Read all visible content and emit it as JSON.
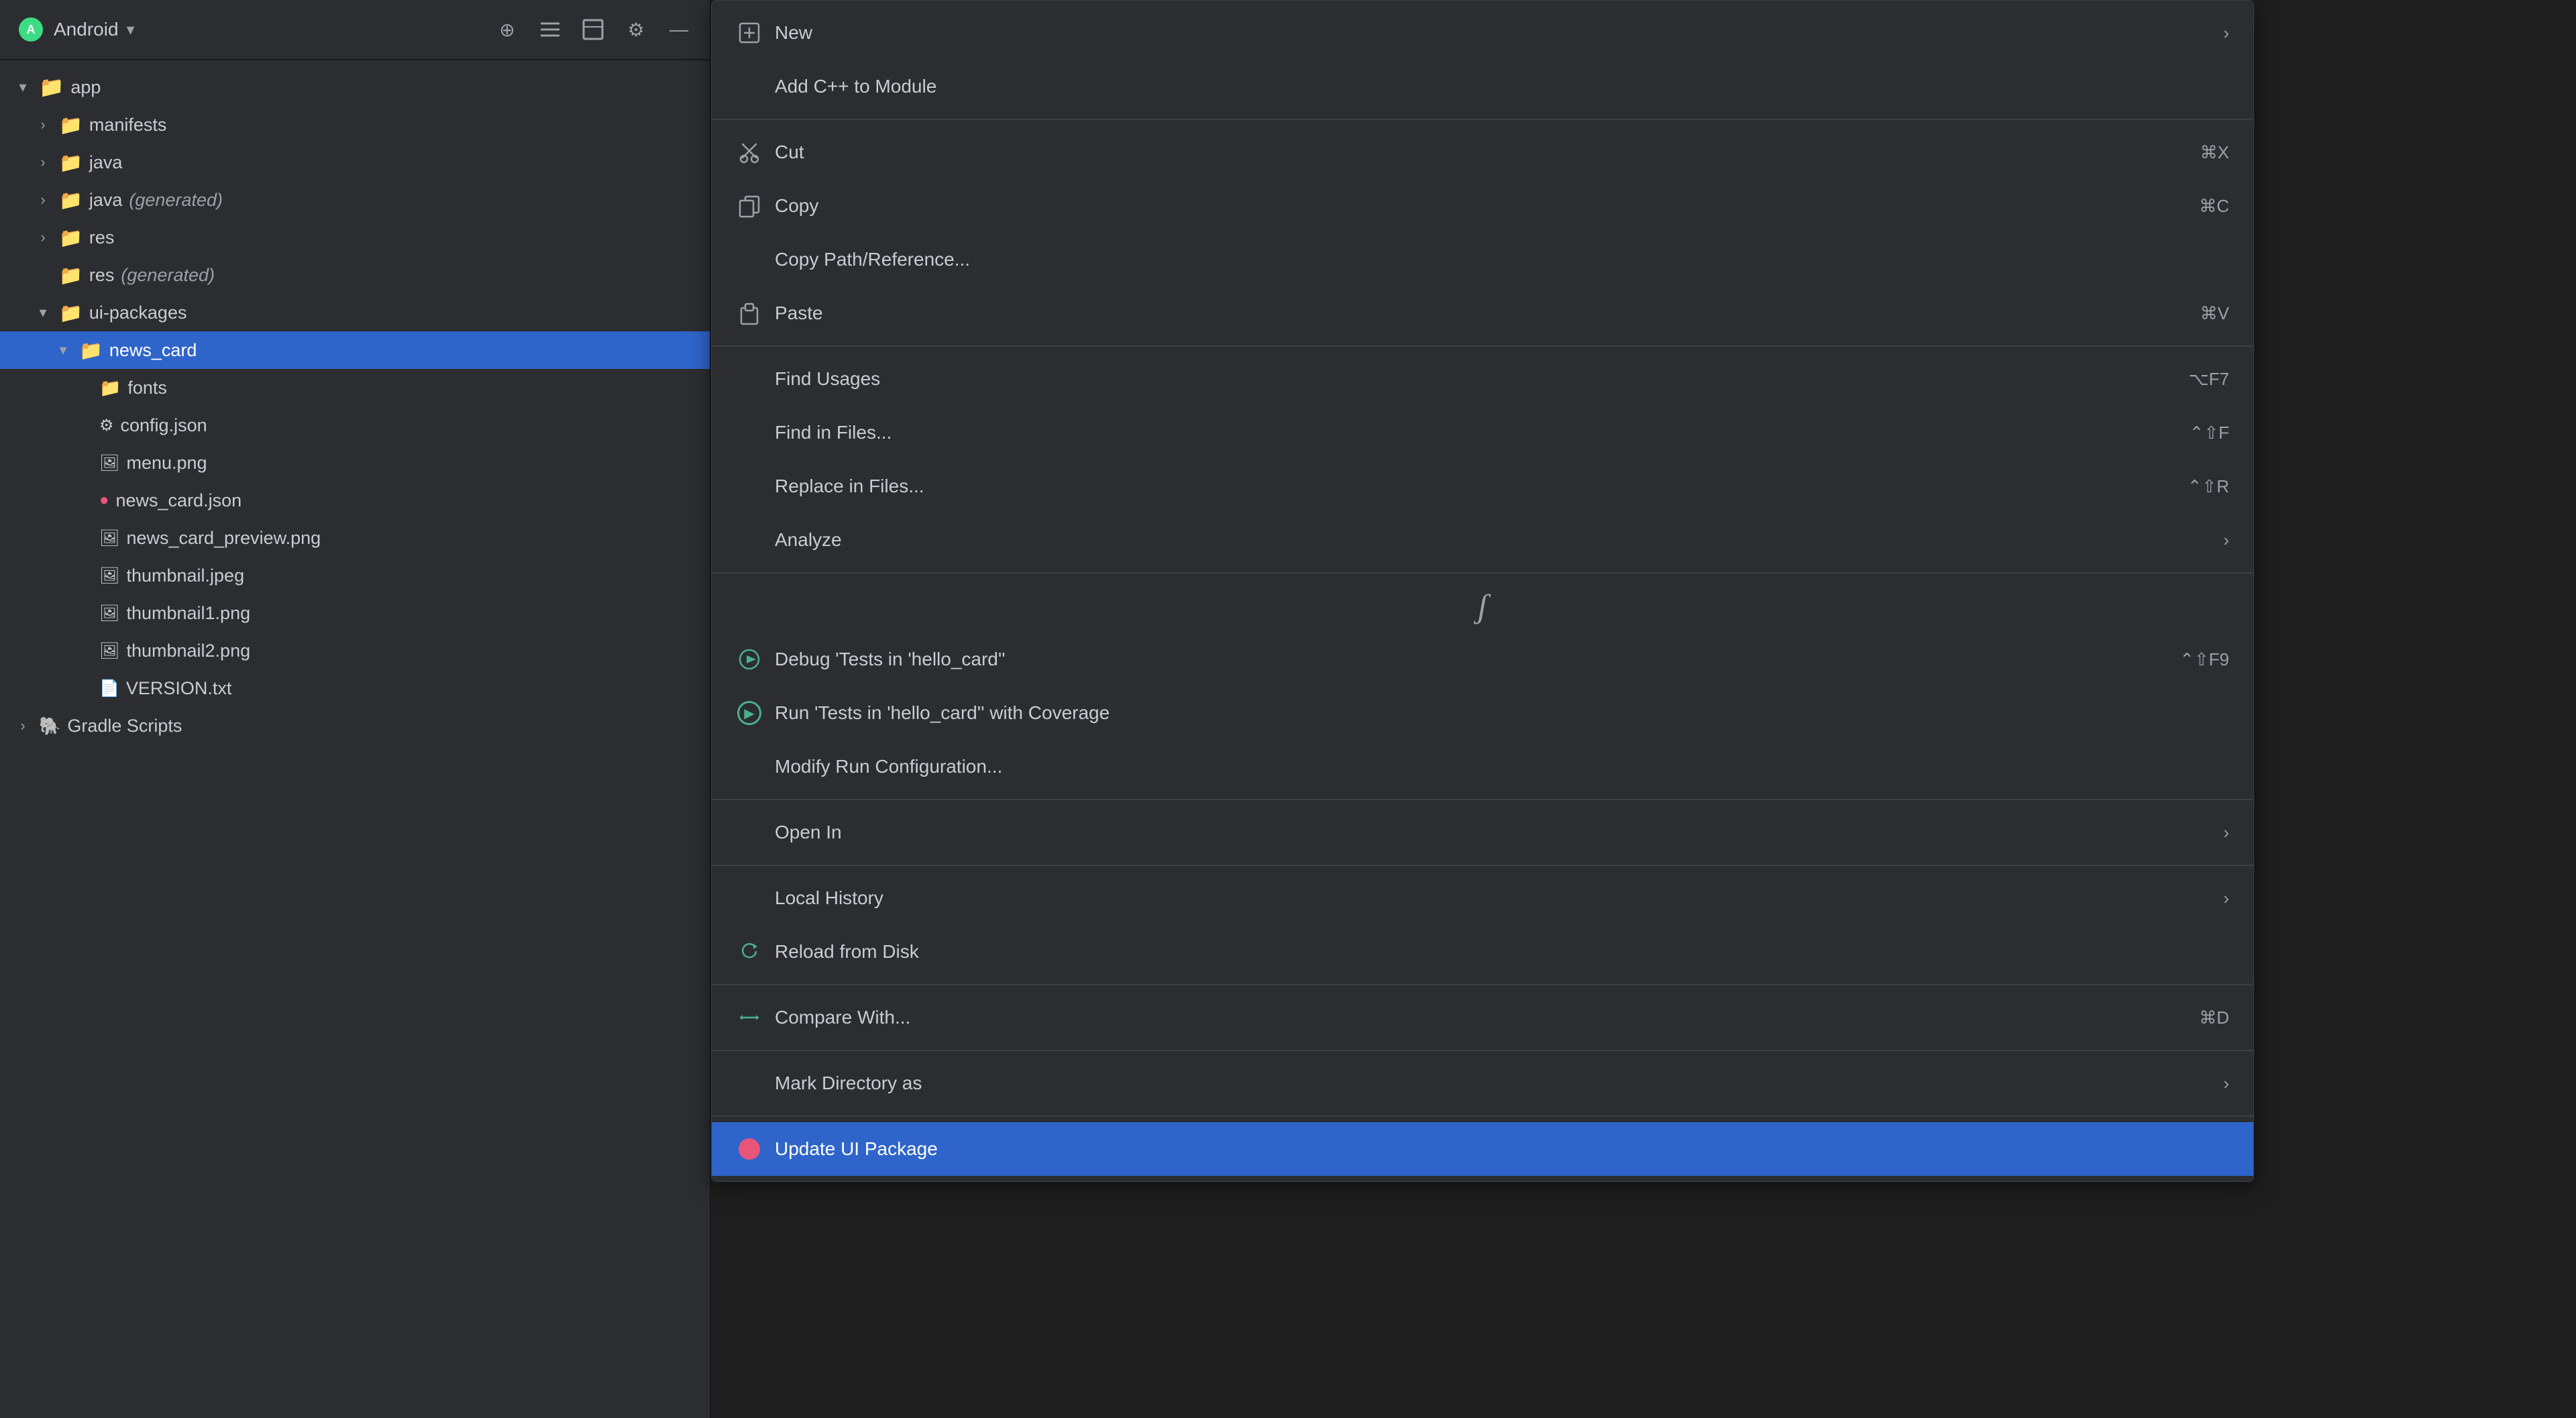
{
  "toolbar": {
    "title": "Android",
    "chevron": "▾",
    "buttons": [
      {
        "name": "target-icon",
        "symbol": "⊕"
      },
      {
        "name": "collapse-all-icon",
        "symbol": "≡"
      },
      {
        "name": "expand-all-icon",
        "symbol": "⊟"
      },
      {
        "name": "settings-icon",
        "symbol": "⚙"
      },
      {
        "name": "minimize-icon",
        "symbol": "—"
      }
    ]
  },
  "file_tree": {
    "items": [
      {
        "id": "app",
        "label": "app",
        "indent": 0,
        "chevron": "▾",
        "icon_type": "folder",
        "selected": false
      },
      {
        "id": "manifests",
        "label": "manifests",
        "indent": 1,
        "chevron": "›",
        "icon_type": "folder",
        "selected": false
      },
      {
        "id": "java",
        "label": "java",
        "indent": 1,
        "chevron": "›",
        "icon_type": "folder_teal",
        "selected": false
      },
      {
        "id": "java_gen",
        "label": "java",
        "indent": 1,
        "chevron": "›",
        "icon_type": "folder_teal",
        "suffix": " (generated)",
        "selected": false
      },
      {
        "id": "res",
        "label": "res",
        "indent": 1,
        "chevron": "›",
        "icon_type": "folder",
        "selected": false
      },
      {
        "id": "res_gen",
        "label": "res",
        "indent": 1,
        "chevron": "",
        "icon_type": "folder",
        "suffix": " (generated)",
        "selected": false
      },
      {
        "id": "ui_packages",
        "label": "ui-packages",
        "indent": 1,
        "chevron": "▾",
        "icon_type": "folder",
        "selected": false
      },
      {
        "id": "news_card",
        "label": "news_card",
        "indent": 2,
        "chevron": "▾",
        "icon_type": "folder",
        "selected": true
      },
      {
        "id": "fonts",
        "label": "fonts",
        "indent": 3,
        "chevron": "",
        "icon_type": "folder",
        "selected": false
      },
      {
        "id": "config_json",
        "label": "config.json",
        "indent": 3,
        "chevron": "",
        "icon_type": "file_gear",
        "selected": false
      },
      {
        "id": "menu_png",
        "label": "menu.png",
        "indent": 3,
        "chevron": "",
        "icon_type": "file_img",
        "selected": false
      },
      {
        "id": "news_card_json",
        "label": "news_card.json",
        "indent": 3,
        "chevron": "",
        "icon_type": "file_red",
        "selected": false
      },
      {
        "id": "news_card_preview",
        "label": "news_card_preview.png",
        "indent": 3,
        "chevron": "",
        "icon_type": "file_img",
        "selected": false
      },
      {
        "id": "thumbnail_jpeg",
        "label": "thumbnail.jpeg",
        "indent": 3,
        "chevron": "",
        "icon_type": "file_img",
        "selected": false
      },
      {
        "id": "thumbnail1_png",
        "label": "thumbnail1.png",
        "indent": 3,
        "chevron": "",
        "icon_type": "file_img",
        "selected": false
      },
      {
        "id": "thumbnail2_png",
        "label": "thumbnail2.png",
        "indent": 3,
        "chevron": "",
        "icon_type": "file_img",
        "selected": false
      },
      {
        "id": "version_txt",
        "label": "VERSION.txt",
        "indent": 3,
        "chevron": "",
        "icon_type": "file",
        "selected": false
      },
      {
        "id": "gradle",
        "label": "Gradle Scripts",
        "indent": 0,
        "chevron": "›",
        "icon_type": "gradle",
        "selected": false
      }
    ]
  },
  "context_menu": {
    "items": [
      {
        "id": "new",
        "label": "New",
        "icon": "new",
        "shortcut": "",
        "has_arrow": true,
        "separator_after": false,
        "highlighted": false,
        "indent_no_icon": false
      },
      {
        "id": "add_cpp",
        "label": "Add C++ to Module",
        "icon": "",
        "shortcut": "",
        "has_arrow": false,
        "separator_after": true,
        "highlighted": false,
        "indent_no_icon": true
      },
      {
        "id": "cut",
        "label": "Cut",
        "icon": "cut",
        "shortcut": "⌘X",
        "has_arrow": false,
        "separator_after": false,
        "highlighted": false,
        "indent_no_icon": false
      },
      {
        "id": "copy",
        "label": "Copy",
        "icon": "copy",
        "shortcut": "⌘C",
        "has_arrow": false,
        "separator_after": false,
        "highlighted": false,
        "indent_no_icon": false
      },
      {
        "id": "copy_path",
        "label": "Copy Path/Reference...",
        "icon": "",
        "shortcut": "",
        "has_arrow": false,
        "separator_after": false,
        "highlighted": false,
        "indent_no_icon": true
      },
      {
        "id": "paste",
        "label": "Paste",
        "icon": "paste",
        "shortcut": "⌘V",
        "has_arrow": false,
        "separator_after": true,
        "highlighted": false,
        "indent_no_icon": false
      },
      {
        "id": "find_usages",
        "label": "Find Usages",
        "icon": "",
        "shortcut": "⌥F7",
        "has_arrow": false,
        "separator_after": false,
        "highlighted": false,
        "indent_no_icon": true
      },
      {
        "id": "find_in_files",
        "label": "Find in Files...",
        "icon": "",
        "shortcut": "⌃⇧F",
        "has_arrow": false,
        "separator_after": false,
        "highlighted": false,
        "indent_no_icon": true
      },
      {
        "id": "replace_in_files",
        "label": "Replace in Files...",
        "icon": "",
        "shortcut": "⌃⇧R",
        "has_arrow": false,
        "separator_after": false,
        "highlighted": false,
        "indent_no_icon": true
      },
      {
        "id": "analyze",
        "label": "Analyze",
        "icon": "",
        "shortcut": "",
        "has_arrow": true,
        "separator_after": true,
        "highlighted": false,
        "indent_no_icon": true
      },
      {
        "id": "spinner",
        "label": "",
        "icon": "spinner",
        "shortcut": "",
        "has_arrow": false,
        "separator_after": false,
        "highlighted": false,
        "indent_no_icon": false
      },
      {
        "id": "debug",
        "label": "Debug 'Tests in 'hello_card''",
        "icon": "debug",
        "shortcut": "⌃⇧F9",
        "has_arrow": false,
        "separator_after": false,
        "highlighted": false,
        "indent_no_icon": false
      },
      {
        "id": "run_coverage",
        "label": "Run 'Tests in 'hello_card'' with Coverage",
        "icon": "coverage",
        "shortcut": "",
        "has_arrow": false,
        "separator_after": false,
        "highlighted": false,
        "indent_no_icon": false
      },
      {
        "id": "modify_run",
        "label": "Modify Run Configuration...",
        "icon": "",
        "shortcut": "",
        "has_arrow": false,
        "separator_after": true,
        "highlighted": false,
        "indent_no_icon": true
      },
      {
        "id": "open_in",
        "label": "Open In",
        "icon": "",
        "shortcut": "",
        "has_arrow": true,
        "separator_after": true,
        "highlighted": false,
        "indent_no_icon": true
      },
      {
        "id": "local_history",
        "label": "Local History",
        "icon": "",
        "shortcut": "",
        "has_arrow": true,
        "separator_after": false,
        "highlighted": false,
        "indent_no_icon": true
      },
      {
        "id": "reload_disk",
        "label": "Reload from Disk",
        "icon": "reload",
        "shortcut": "",
        "has_arrow": false,
        "separator_after": true,
        "highlighted": false,
        "indent_no_icon": false
      },
      {
        "id": "compare_with",
        "label": "Compare With...",
        "icon": "compare",
        "shortcut": "⌘D",
        "has_arrow": false,
        "separator_after": true,
        "highlighted": false,
        "indent_no_icon": false
      },
      {
        "id": "mark_directory",
        "label": "Mark Directory as",
        "icon": "",
        "shortcut": "",
        "has_arrow": true,
        "separator_after": true,
        "highlighted": false,
        "indent_no_icon": true
      },
      {
        "id": "update_ui",
        "label": "Update UI Package",
        "icon": "pink_dot",
        "shortcut": "",
        "has_arrow": false,
        "separator_after": false,
        "highlighted": true,
        "indent_no_icon": false
      }
    ]
  }
}
